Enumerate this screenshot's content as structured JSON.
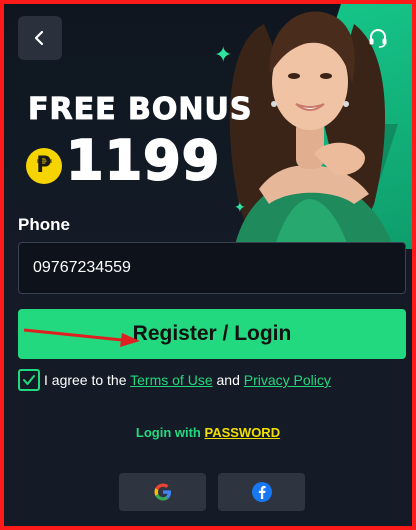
{
  "hero": {
    "bonus_title": "FREE BONUS",
    "currency_symbol": "₱",
    "bonus_amount": "1199"
  },
  "icons": {
    "back": "chevron-left-icon",
    "support": "headset-icon",
    "google": "google-icon",
    "facebook": "facebook-icon",
    "check": "check-icon",
    "sparkle": "sparkle-icon",
    "peso": "peso-coin-icon"
  },
  "form": {
    "phone_label": "Phone",
    "phone_value": "09767234559",
    "register_label": "Register / Login",
    "checkbox_checked": true,
    "agree_prefix": "I agree to the ",
    "terms_label": "Terms of Use",
    "agree_and": " and ",
    "privacy_label": "Privacy Policy",
    "login_with_prefix": "Login with ",
    "password_label": "PASSWORD"
  },
  "colors": {
    "accent_green": "#22d97f",
    "background": "#141a26",
    "password_yellow": "#f0e000",
    "border_red": "#ff1a1a"
  }
}
